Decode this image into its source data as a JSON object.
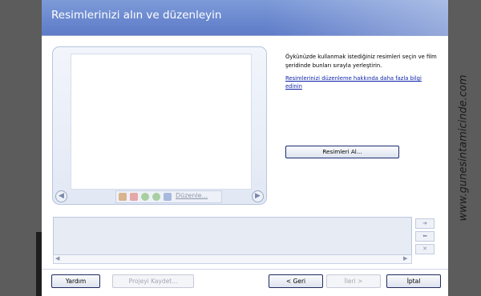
{
  "header": {
    "title": "Resimlerinizi alın ve düzenleyin"
  },
  "preview": {
    "toolbar": {
      "edit_label": "Düzenle..."
    },
    "icons": [
      "chart-icon",
      "image-icon",
      "rotate-left-icon",
      "rotate-right-icon",
      "picture-edit-icon"
    ]
  },
  "info": {
    "description": "Öykünüzde kullanmak istediğiniz resimleri seçin ve film şeridinde bunları sırayla yerleştirin.",
    "help_link": "Resimlerinizi düzenleme hakkında daha fazla bilgi edinin",
    "get_pictures_label": "Resimleri Al..."
  },
  "footer": {
    "help_label": "Yardım",
    "save_project_label": "Projeyi Kaydet...",
    "back_label": "< Geri",
    "next_label": "İleri >",
    "cancel_label": "İptal"
  },
  "watermark": "www.gunesintamicinde.com",
  "colors": {
    "header": "#6b88cf",
    "link": "#0b1fa8",
    "panel_border": "#b9c6e0"
  }
}
